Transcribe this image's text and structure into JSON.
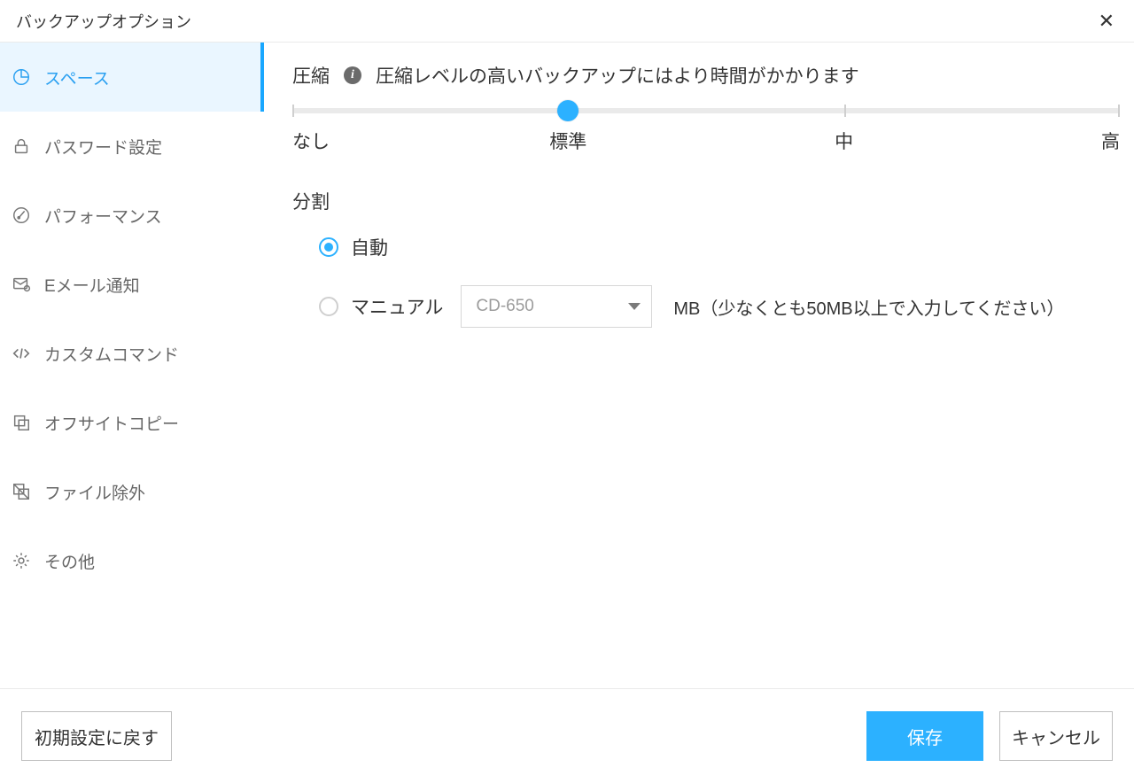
{
  "header": {
    "title": "バックアップオプション"
  },
  "sidebar": {
    "items": [
      {
        "label": "スペース"
      },
      {
        "label": "パスワード設定"
      },
      {
        "label": "パフォーマンス"
      },
      {
        "label": "Eメール通知"
      },
      {
        "label": "カスタムコマンド"
      },
      {
        "label": "オフサイトコピー"
      },
      {
        "label": "ファイル除外"
      },
      {
        "label": "その他"
      }
    ]
  },
  "compression": {
    "title": "圧縮",
    "description": "圧縮レベルの高いバックアップにはより時間がかかります",
    "levels": {
      "none": "なし",
      "standard": "標準",
      "medium": "中",
      "high": "高"
    },
    "selected_index": 1
  },
  "split": {
    "title": "分割",
    "auto_label": "自動",
    "manual_label": "マニュアル",
    "selected": "auto",
    "select_value": "CD-650",
    "mb_note": "MB（少なくとも50MB以上で入力してください）"
  },
  "footer": {
    "reset": "初期設定に戻す",
    "save": "保存",
    "cancel": "キャンセル"
  }
}
